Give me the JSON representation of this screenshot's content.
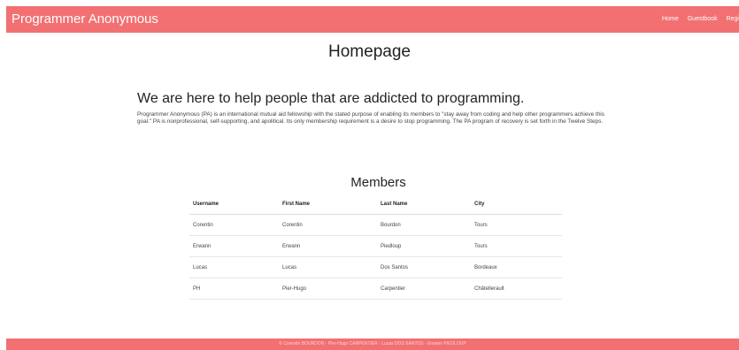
{
  "navbar": {
    "brand": "Programmer Anonymous",
    "links": [
      "Home",
      "Guestbook",
      "Regi"
    ]
  },
  "page": {
    "title": "Homepage"
  },
  "hero": {
    "heading": "We are here to help people that are addicted to programming.",
    "text": "Programmer Anonymous (PA) is an international mutual aid fellowship with the stated purpose of enabling its members to \"stay away from coding and help other programmers achieve this goal.\" PA is nonprofessional, self-supporting, and apolitical. Its only membership requirement is a desire to stop programming. The PA program of recovery is set forth in the Twelve Steps."
  },
  "members": {
    "title": "Members",
    "columns": [
      "Username",
      "First Name",
      "Last Name",
      "City"
    ],
    "rows": [
      [
        "Corentin",
        "Corentin",
        "Bourdon",
        "Tours"
      ],
      [
        "Erwann",
        "Erwann",
        "Piedloup",
        "Tours"
      ],
      [
        "Lucas",
        "Lucas",
        "Dos Santos",
        "Bordeaux"
      ],
      [
        "PH",
        "Pier-Hugo",
        "Carpentier",
        "Châtellerault"
      ]
    ]
  },
  "footer": {
    "text": "© Corentin BOURDON - Pier-Hugo CARPENTIER - Lucas DOS SANTOS - Erwann PIEDLOUP"
  },
  "colors": {
    "brand": "#f27072"
  }
}
